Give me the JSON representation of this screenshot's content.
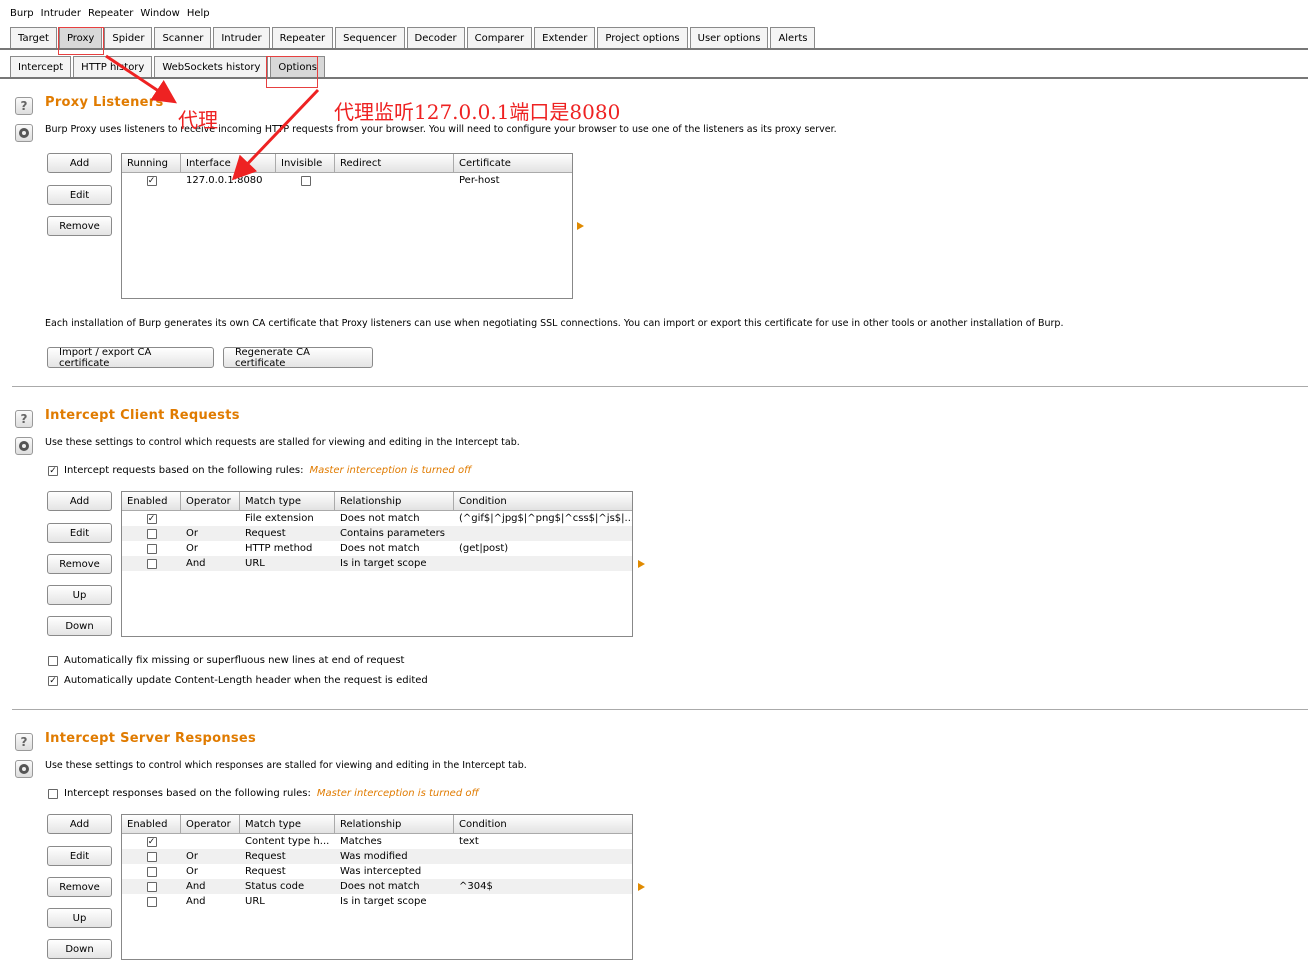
{
  "menu": [
    "Burp",
    "Intruder",
    "Repeater",
    "Window",
    "Help"
  ],
  "main_tabs": [
    "Target",
    "Proxy",
    "Spider",
    "Scanner",
    "Intruder",
    "Repeater",
    "Sequencer",
    "Decoder",
    "Comparer",
    "Extender",
    "Project options",
    "User options",
    "Alerts"
  ],
  "sub_tabs": [
    "Intercept",
    "HTTP history",
    "WebSockets history",
    "Options"
  ],
  "annotations": {
    "proxy": "代理",
    "listener": "代理监听127.0.0.1端口是8080"
  },
  "listeners": {
    "title": "Proxy Listeners",
    "desc": "Burp Proxy uses listeners to receive incoming HTTP requests from your browser. You will need to configure your browser to use one of the listeners as its proxy server.",
    "buttons": [
      "Add",
      "Edit",
      "Remove"
    ],
    "columns": [
      "Running",
      "Interface",
      "Invisible",
      "Redirect",
      "Certificate"
    ],
    "rows": [
      {
        "running": true,
        "interface": "127.0.0.1:8080",
        "invisible": false,
        "redirect": "",
        "certificate": "Per-host"
      }
    ],
    "ca_desc": "Each installation of Burp generates its own CA certificate that Proxy listeners can use when negotiating SSL connections. You can import or export this certificate for use in other tools or another installation of Burp.",
    "import_btn": "Import / export CA certificate",
    "regen_btn": "Regenerate CA certificate"
  },
  "requests": {
    "title": "Intercept Client Requests",
    "desc": "Use these settings to control which requests are stalled for viewing and editing in the Intercept tab.",
    "rule_label": "Intercept requests based on the following rules:",
    "rule_checked": true,
    "note": "Master interception is turned off",
    "buttons": [
      "Add",
      "Edit",
      "Remove",
      "Up",
      "Down"
    ],
    "columns": [
      "Enabled",
      "Operator",
      "Match type",
      "Relationship",
      "Condition"
    ],
    "rows": [
      {
        "enabled": true,
        "op": "",
        "match": "File extension",
        "rel": "Does not match",
        "cond": "(^gif$|^jpg$|^png$|^css$|^js$|..."
      },
      {
        "enabled": false,
        "op": "Or",
        "match": "Request",
        "rel": "Contains parameters",
        "cond": ""
      },
      {
        "enabled": false,
        "op": "Or",
        "match": "HTTP method",
        "rel": "Does not match",
        "cond": "(get|post)"
      },
      {
        "enabled": false,
        "op": "And",
        "match": "URL",
        "rel": "Is in target scope",
        "cond": ""
      }
    ],
    "opt1": "Automatically fix missing or superfluous new lines at end of request",
    "opt1_checked": false,
    "opt2": "Automatically update Content-Length header when the request is edited",
    "opt2_checked": true
  },
  "responses": {
    "title": "Intercept Server Responses",
    "desc": "Use these settings to control which responses are stalled for viewing and editing in the Intercept tab.",
    "rule_label": "Intercept responses based on the following rules:",
    "rule_checked": false,
    "note": "Master interception is turned off",
    "buttons": [
      "Add",
      "Edit",
      "Remove",
      "Up",
      "Down"
    ],
    "columns": [
      "Enabled",
      "Operator",
      "Match type",
      "Relationship",
      "Condition"
    ],
    "rows": [
      {
        "enabled": true,
        "op": "",
        "match": "Content type h...",
        "rel": "Matches",
        "cond": "text"
      },
      {
        "enabled": false,
        "op": "Or",
        "match": "Request",
        "rel": "Was modified",
        "cond": ""
      },
      {
        "enabled": false,
        "op": "Or",
        "match": "Request",
        "rel": "Was intercepted",
        "cond": ""
      },
      {
        "enabled": false,
        "op": "And",
        "match": "Status code",
        "rel": "Does not match",
        "cond": "^304$"
      },
      {
        "enabled": false,
        "op": "And",
        "match": "URL",
        "rel": "Is in target scope",
        "cond": ""
      }
    ]
  },
  "colors": {
    "accent": "#e07b00",
    "annotation": "#ee2222"
  }
}
